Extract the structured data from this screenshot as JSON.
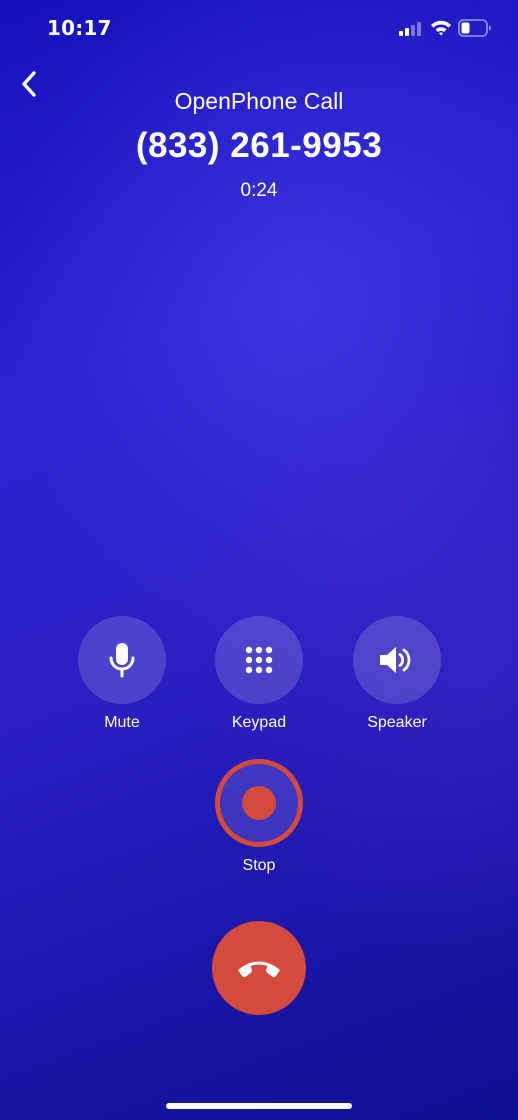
{
  "status_bar": {
    "time": "10:17",
    "icons": [
      "signal-icon",
      "wifi-icon",
      "battery-icon"
    ]
  },
  "header": {
    "back_icon": "chevron-left-icon",
    "caller_label": "OpenPhone Call",
    "phone_number": "(833) 261-9953",
    "duration": "0:24"
  },
  "controls": {
    "mute": {
      "label": "Mute",
      "icon": "microphone-icon"
    },
    "keypad": {
      "label": "Keypad",
      "icon": "keypad-icon"
    },
    "speaker": {
      "label": "Speaker",
      "icon": "speaker-icon"
    },
    "record": {
      "label": "Stop",
      "icon": "record-icon"
    },
    "end_call": {
      "icon": "hang-up-icon"
    }
  },
  "colors": {
    "background": "#2a22cf",
    "accent_red": "#d44b3e",
    "text": "#ffffff"
  }
}
